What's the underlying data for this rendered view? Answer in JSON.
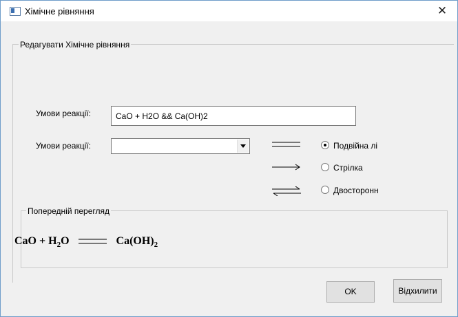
{
  "window": {
    "title": "Хімічне рівняння",
    "close_glyph": "✕"
  },
  "group": {
    "legend": "Редагувати Хімічне рівняння"
  },
  "conditions_input": {
    "label": "Умови реакції:",
    "value": "CaO + H2O && Ca(OH)2"
  },
  "conditions_combo": {
    "label": "Умови реакції:",
    "value": ""
  },
  "arrow_options": [
    {
      "label": "Подвійна лі",
      "symbol": "double-line-icon",
      "selected": true
    },
    {
      "label": "Стрілка",
      "symbol": "right-arrow-icon",
      "selected": false
    },
    {
      "label": "Двосторонн",
      "symbol": "equilibrium-arrows-icon",
      "selected": false
    }
  ],
  "preview": {
    "legend": "Попередній перегляд",
    "reactant1": "CaO",
    "plus": "+",
    "reactant2_main": "H",
    "reactant2_sub": "2",
    "reactant2_tail": "O",
    "product_main": "Ca(OH)",
    "product_sub": "2"
  },
  "buttons": {
    "ok": "OK",
    "cancel": "Відхилити"
  }
}
